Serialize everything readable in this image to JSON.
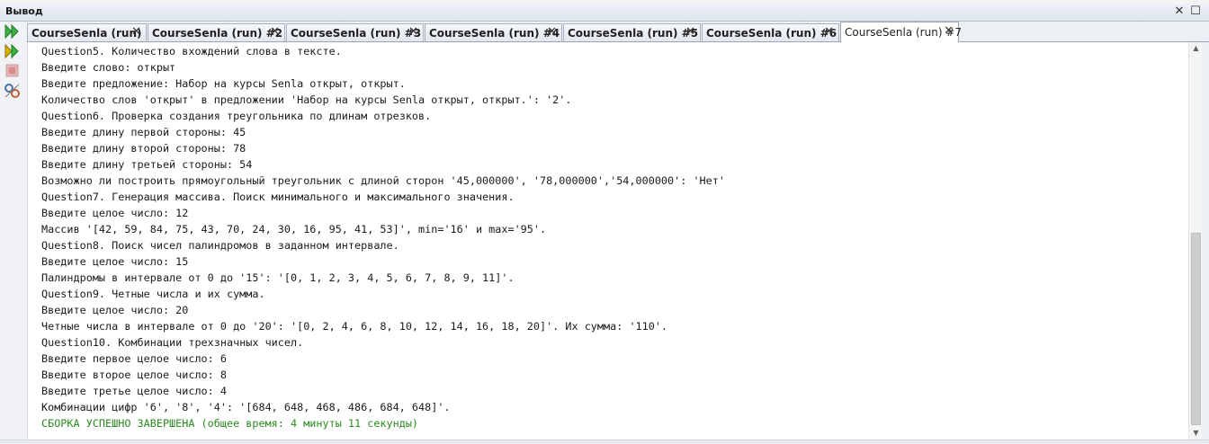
{
  "window": {
    "title": "Вывод",
    "restore_glyph": "✕",
    "close_glyph": "☐"
  },
  "tabs": [
    {
      "label": "CourseSenla (run)",
      "close": "✕"
    },
    {
      "label": "CourseSenla (run) #2",
      "close": "✕"
    },
    {
      "label": "CourseSenla (run) #3",
      "close": "✕"
    },
    {
      "label": "CourseSenla (run) #4",
      "close": "✕"
    },
    {
      "label": "CourseSenla (run) #5",
      "close": "✕"
    },
    {
      "label": "CourseSenla (run) #6",
      "close": "✕"
    },
    {
      "label": "CourseSenla (run) #7",
      "close": "✕"
    }
  ],
  "active_tab_index": 6,
  "toolbar": {
    "buttons": [
      "rerun-icon",
      "rerun-with-params-icon",
      "stop-icon",
      "settings-icon"
    ]
  },
  "output": {
    "lines": [
      "Question5. Количество вхождений слова в тексте.",
      "Введите слово: открыт",
      "Введите предложение: Набор на курсы Senla открыт, открыт.",
      "Количество слов 'открыт' в предложении 'Набор на курсы Senla открыт, открыт.': '2'.",
      "Question6. Проверка создания треугольника по длинам отрезков.",
      "Введите длину первой стороны: 45",
      "Введите длину второй стороны: 78",
      "Введите длину третьей стороны: 54",
      "Возможно ли построить прямоугольный треугольник с длиной сторон '45,000000', '78,000000','54,000000': 'Нет'",
      "Question7. Генерация массива. Поиск минимального и максимального значения.",
      "Введите целое число: 12",
      "Массив '[42, 59, 84, 75, 43, 70, 24, 30, 16, 95, 41, 53]', min='16' и max='95'.",
      "Question8. Поиск чисел палиндромов в заданном интервале.",
      "Введите целое число: 15",
      "Палиндромы в интервале от 0 до '15': '[0, 1, 2, 3, 4, 5, 6, 7, 8, 9, 11]'.",
      "Question9. Четные числа и их сумма.",
      "Введите целое число: 20",
      "Четные числа в интервале от 0 до '20': '[0, 2, 4, 6, 8, 10, 12, 14, 16, 18, 20]'. Их сумма: '110'.",
      "Question10. Комбинации трехзначных чисел.",
      "Введите первое целое число: 6",
      "Введите второе целое число: 8",
      "Введите третье целое число: 4",
      "Комбинации цифр '6', '8', '4': '[684, 648, 468, 486, 684, 648]'."
    ],
    "success_line": "СБОРКА УСПЕШНО ЗАВЕРШЕНА (общее время: 4 минуты 11 секунды)"
  },
  "scrollbar": {
    "up_glyph": "▲",
    "down_glyph": "▼",
    "position": 0.62
  },
  "colors": {
    "success_text": "#2a8a1f",
    "normal_text": "#1a1a1a"
  }
}
